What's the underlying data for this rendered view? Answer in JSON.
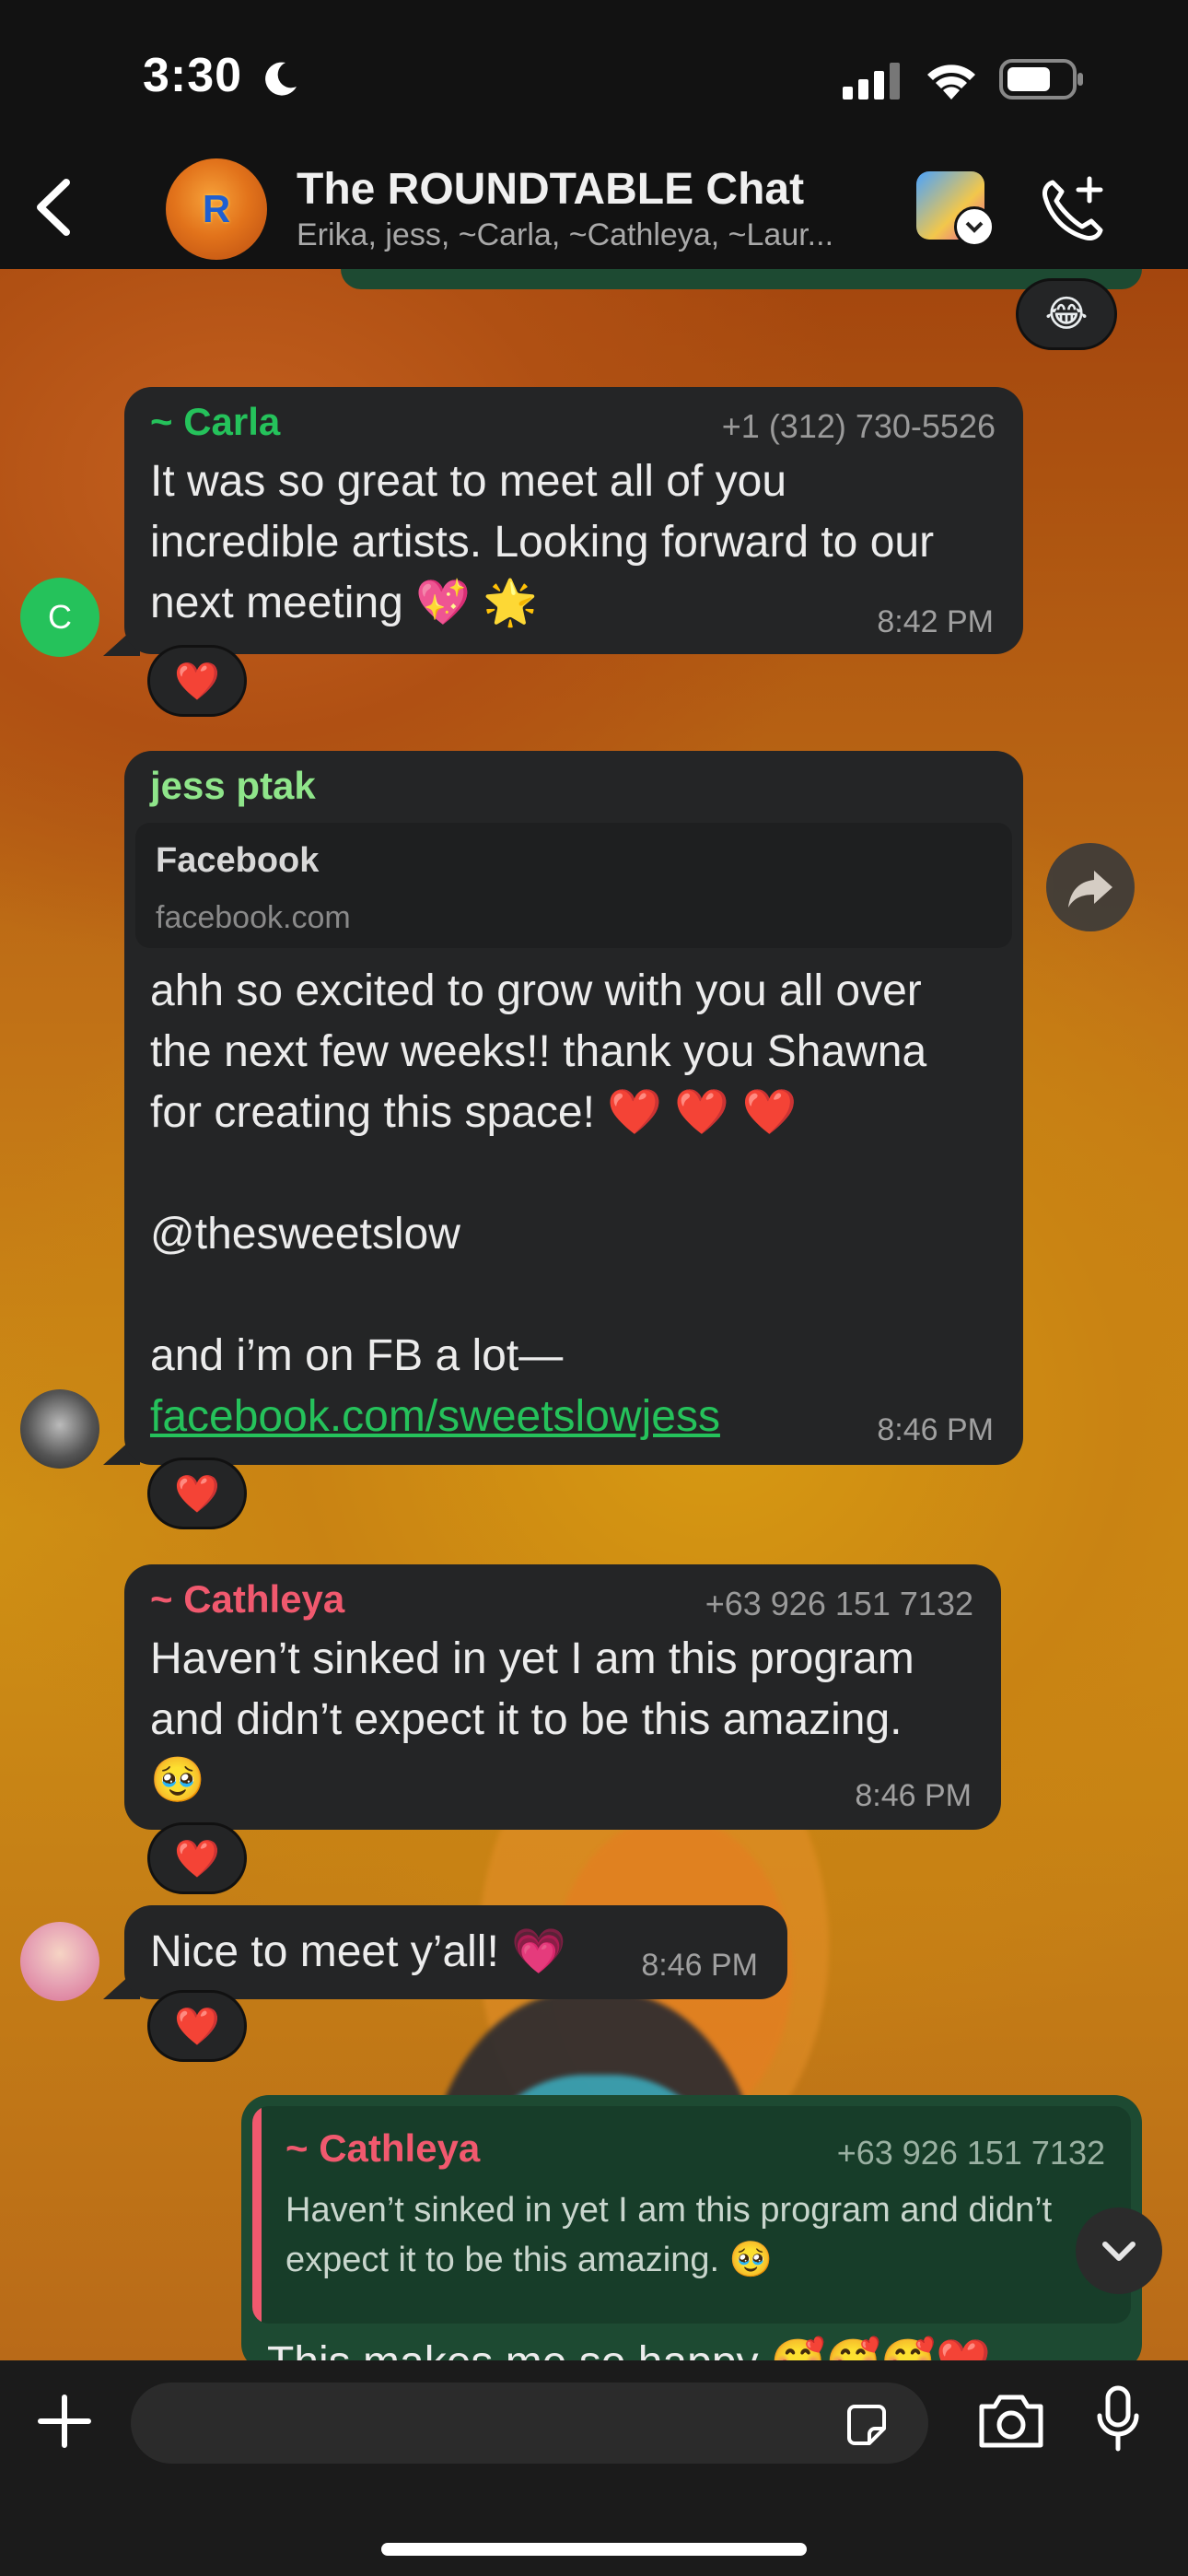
{
  "status_bar": {
    "time": "3:30"
  },
  "header": {
    "title": "The ROUNDTABLE Chat",
    "members": "Erika, jess, ~Carla, ~Cathleya, ~Laur...",
    "avatar_letter": "R"
  },
  "top_reaction": "😂",
  "messages": [
    {
      "sender": "~ Carla",
      "phone": "+1 (312) 730-5526",
      "text": "It was so great to meet all of you\nincredible artists. Looking forward to our\nnext meeting 💖 🌟",
      "time": "8:42 PM",
      "reaction": "❤️",
      "avatar_initial": "C"
    },
    {
      "sender": "jess ptak",
      "link_preview": {
        "title": "Facebook",
        "domain": "facebook.com"
      },
      "text": "ahh so excited to grow with you all over\nthe next few weeks!! thank you Shawna\nfor creating this space! ❤️ ❤️ ❤️\n\n@thesweetslow\n\nand i’m on FB a lot—",
      "link": "facebook.com/sweetslowjess",
      "time": "8:46 PM",
      "reaction": "❤️"
    },
    {
      "sender": "~ Cathleya",
      "phone": "+63 926 151 7132",
      "text": "Haven’t sinked in yet I am this program\nand didn’t expect it to be this amazing.\n🥹",
      "time": "8:46 PM",
      "reaction": "❤️"
    },
    {
      "text": "Nice to meet y’all! 💗",
      "time": "8:46 PM",
      "reaction": "❤️"
    }
  ],
  "reply": {
    "quoted_sender": "~ Cathleya",
    "quoted_phone": "+63 926 151 7132",
    "quoted_text": "Haven’t sinked in yet I am this program and didn’t\nexpect it to be this amazing. 🥹",
    "text_partial": "This makes me so happy 🥰🥰🥰❤️"
  },
  "colors": {
    "carla": "#25c25b",
    "jess": "#8fe58a",
    "cathleya": "#f0596e",
    "link": "#25c25b",
    "own_bubble": "#1d4a32"
  }
}
